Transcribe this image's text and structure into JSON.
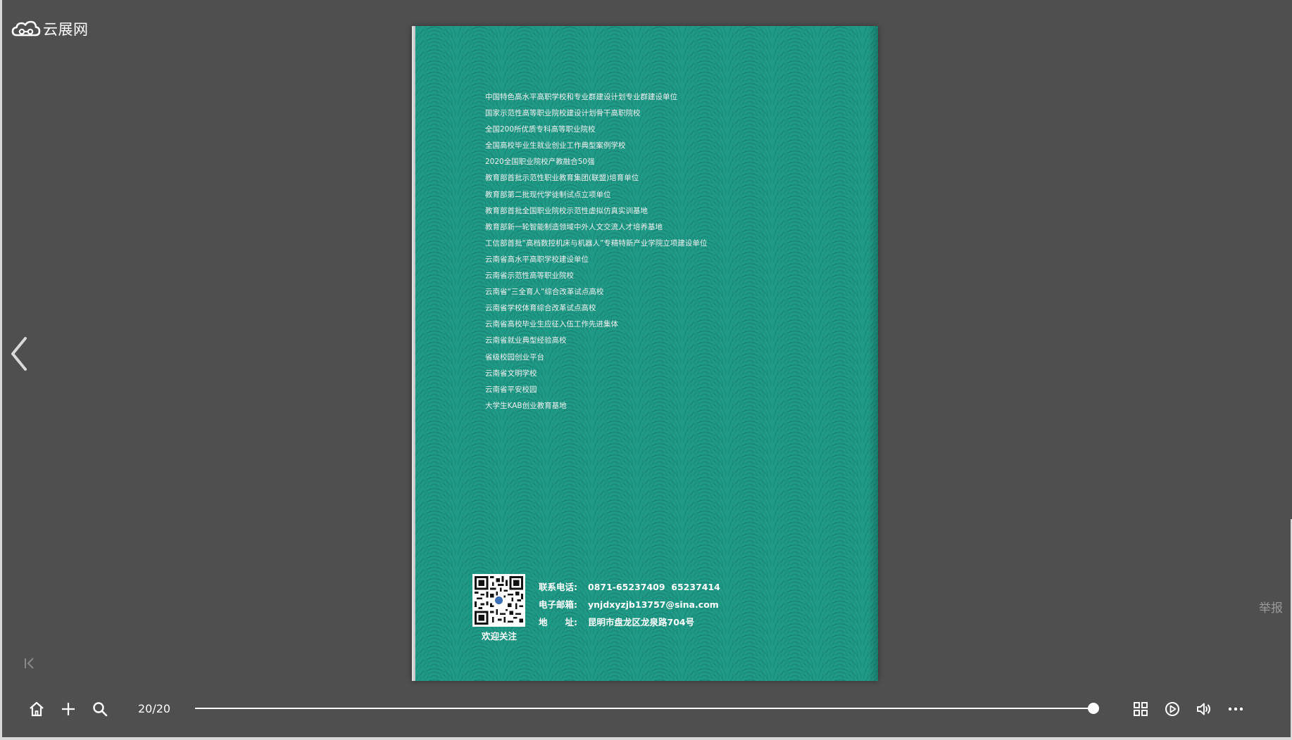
{
  "logo": {
    "text": "云展网"
  },
  "page": {
    "honors": [
      "中国特色高水平高职学校和专业群建设计划专业群建设单位",
      "国家示范性高等职业院校建设计划骨干高职院校",
      "全国200所优质专科高等职业院校",
      "全国高校毕业生就业创业工作典型案例学校",
      "2020全国职业院校产教融合50强",
      "教育部首批示范性职业教育集团(联盟)培育单位",
      "教育部第二批现代学徒制试点立项单位",
      "教育部首批全国职业院校示范性虚拟仿真实训基地",
      "教育部新一轮智能制造领域中外人文交流人才培养基地",
      "工信部首批“高档数控机床与机器人”专精特新产业学院立项建设单位",
      "云南省高水平高职学校建设单位",
      "云南省示范性高等职业院校",
      "云南省“三全育人”综合改革试点高校",
      "云南省学校体育综合改革试点高校",
      "云南省高校毕业生应征入伍工作先进集体",
      "云南省就业典型经验高校",
      "省级校园创业平台",
      "云南省文明学校",
      "云南省平安校园",
      "大学生KAB创业教育基地"
    ],
    "qr_caption": "欢迎关注",
    "contact": {
      "phone_label": "联系电话:",
      "phone_value": "0871-65237409  65237414",
      "email_label": "电子邮箱:",
      "email_value": "ynjdxyzjb13757@sina.com",
      "address_label": "地　　址:",
      "address_value": "昆明市盘龙区龙泉路704号"
    },
    "background_color": "#1f9a87"
  },
  "report_label": "举报",
  "toolbar": {
    "page_counter": "20/20",
    "progress": 1.0,
    "icons": [
      "home-icon",
      "zoom-in-icon",
      "search-icon",
      "grid-icon",
      "play-icon",
      "volume-icon",
      "more-icon"
    ]
  }
}
